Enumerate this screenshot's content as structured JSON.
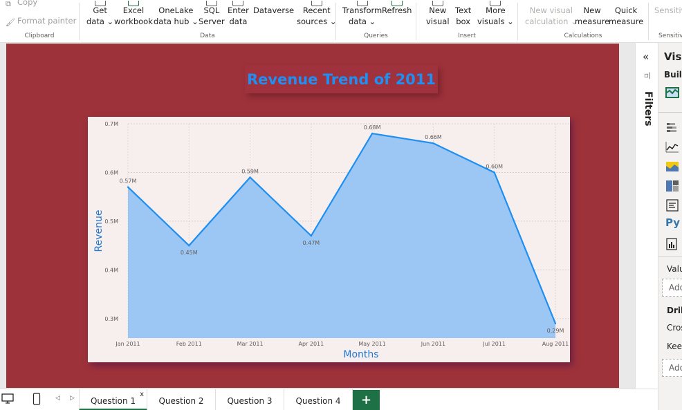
{
  "ribbon": {
    "clipboard": {
      "label": "Clipboard",
      "copy": "Copy",
      "format_painter": "Format painter"
    },
    "data": {
      "label": "Data",
      "get_data": [
        "Get",
        "data ⌄"
      ],
      "excel": [
        "Excel",
        "workbook"
      ],
      "onelake": [
        "OneLake",
        "data hub ⌄"
      ],
      "sql": [
        "SQL",
        "Server"
      ],
      "enter": [
        "Enter",
        "data"
      ],
      "dataverse": [
        "Dataverse",
        ""
      ],
      "recent": [
        "Recent",
        "sources ⌄"
      ]
    },
    "queries": {
      "label": "Queries",
      "transform": [
        "Transform",
        "data ⌄"
      ],
      "refresh": [
        "Refresh",
        ""
      ]
    },
    "insert": {
      "label": "Insert",
      "new_visual": [
        "New",
        "visual"
      ],
      "text_box": [
        "Text",
        "box"
      ],
      "more_visuals": [
        "More",
        "visuals ⌄"
      ]
    },
    "calculations": {
      "label": "Calculations",
      "new_visual_calc": [
        "New visual",
        "calculation ⌄"
      ],
      "new_measure": [
        "New",
        "measure"
      ],
      "quick_measure": [
        "Quick",
        "measure"
      ]
    },
    "sensitivity": {
      "label": "Sensitivi",
      "btn": "Sensitivi"
    }
  },
  "report": {
    "title": "Revenue Trend of 2011"
  },
  "chart_data": {
    "type": "area",
    "x": [
      "Jan 2011",
      "Feb 2011",
      "Mar 2011",
      "Apr 2011",
      "May 2011",
      "Jun 2011",
      "Jul 2011",
      "Aug 2011"
    ],
    "series": [
      {
        "values": [
          0.57,
          0.45,
          0.59,
          0.47,
          0.68,
          0.66,
          0.6,
          0.29
        ],
        "labels": [
          "0.57M",
          "0.45M",
          "0.59M",
          "0.47M",
          "0.68M",
          "0.66M",
          "0.60M",
          "0.29M"
        ]
      }
    ],
    "xlabel": "Months",
    "ylabel": "Revenue",
    "ylim": [
      0.26,
      0.7
    ],
    "yticks": [
      0.3,
      0.4,
      0.5,
      0.6,
      0.7
    ],
    "ytick_labels": [
      "0.3M",
      "0.4M",
      "0.5M",
      "0.6M",
      "0.7M"
    ],
    "grid": true,
    "line_color": "#1e8ff0",
    "fill_color": "#9cc6f3"
  },
  "panes": {
    "filters_label": "Filters",
    "viz_title": "Visu",
    "build_label": "Build",
    "values_label": "Valu",
    "add_1": "Add",
    "drill_label": "Drill",
    "cross_label": "Cros",
    "keep_label": "Keep",
    "add_2": "Add",
    "py_label": "Py"
  },
  "tabs": [
    {
      "label": "Question 1",
      "active": true
    },
    {
      "label": "Question 2",
      "active": false
    },
    {
      "label": "Question 3",
      "active": false
    },
    {
      "label": "Question 4",
      "active": false
    }
  ],
  "tab_close": "x",
  "add_page": "+",
  "colors": {
    "page_bg": "#9e323b",
    "accent_green": "#1e7145",
    "title_blue": "#1f8ff2"
  }
}
